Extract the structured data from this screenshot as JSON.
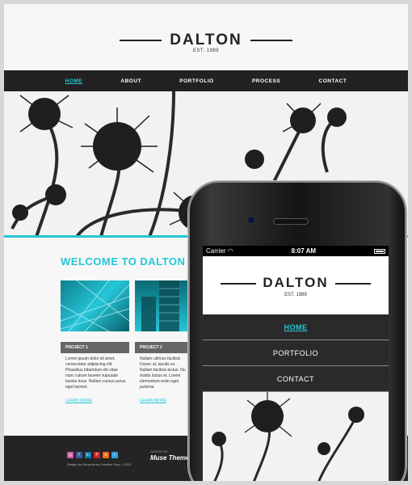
{
  "site": {
    "logo": "DALTON",
    "est": "EST. 1989",
    "nav": [
      "HOME",
      "ABOUT",
      "PORTFOLIO",
      "PROCESS",
      "CONTACT"
    ],
    "welcome": "WELCOME TO DALTON",
    "projects": [
      {
        "title": "PROJECT 1",
        "desc": "Lorem ipsum dolor sit amet, consectetur adipiscing elit. Phasellus bibendum elit vitae nunc rutrum laoreet vulputate lacinia risus. Nullam cursus purus eget laoreet.",
        "link": "LEARN MORE"
      },
      {
        "title": "PROJECT 2",
        "desc": "Nullam ultrices facilisis Donec at, iaculis ex. Nullam facilisis lectus. Nu mattis luctus et. Lorem elementum enim eget pulvinar.",
        "link": "LEARN MORE"
      }
    ],
    "social": [
      "◎",
      "f",
      "in",
      "P",
      "≋",
      "✓"
    ],
    "credit": "Design by Visual Arms Creative Corp. | 2013",
    "designed_by": "DESIGN BY",
    "muse": "Muse Themes"
  },
  "phone": {
    "carrier": "Carrier",
    "time": "8:07 AM",
    "logo": "DALTON",
    "est": "EST. 1989",
    "nav": [
      "HOME",
      "PORTFOLIO",
      "CONTACT"
    ]
  },
  "colors": {
    "accent": "#25c6d8",
    "dark": "#222222"
  }
}
